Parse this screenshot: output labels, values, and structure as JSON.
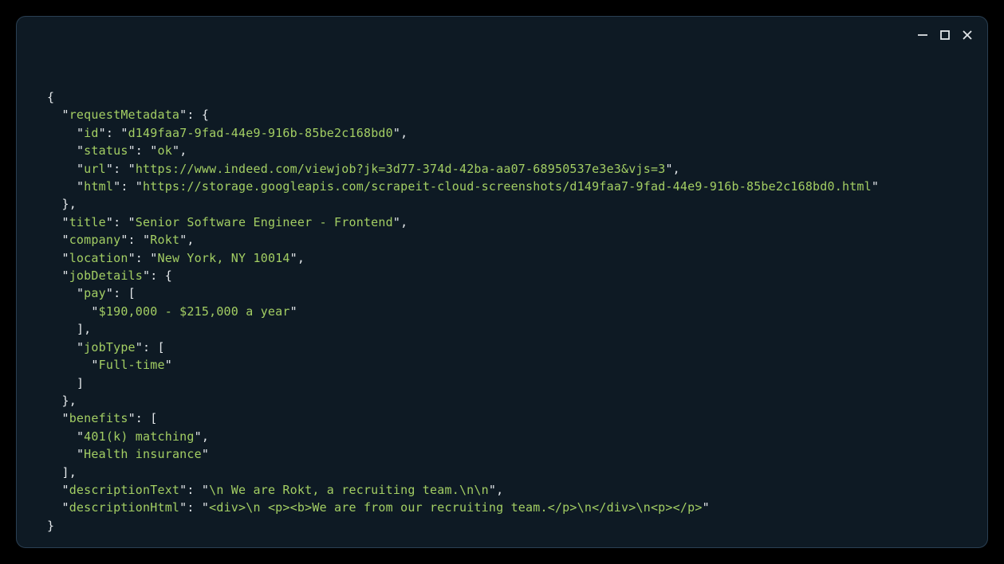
{
  "json": {
    "requestMetadata": {
      "id": "d149faa7-9fad-44e9-916b-85be2c168bd0",
      "status": "ok",
      "url": "https://www.indeed.com/viewjob?jk=3d77-374d-42ba-aa07-68950537e3e3&vjs=3",
      "html": "https://storage.googleapis.com/scrapeit-cloud-screenshots/d149faa7-9fad-44e9-916b-85be2c168bd0.html"
    },
    "title": "Senior Software Engineer - Frontend",
    "company": "Rokt",
    "location": "New York, NY 10014",
    "jobDetails": {
      "pay": [
        "$190,000 - $215,000 a year"
      ],
      "jobType": [
        "Full-time"
      ]
    },
    "benefits": [
      "401(k) matching",
      "Health insurance"
    ],
    "descriptionText": "\\n We are Rokt, a recruiting team.\\n\\n",
    "descriptionHtml": "<div>\\n <p><b>We are from our recruiting team.</p>\\n</div>\\n<p></p>"
  },
  "keys": {
    "requestMetadata": "requestMetadata",
    "id": "id",
    "status": "status",
    "url": "url",
    "html": "html",
    "title": "title",
    "company": "company",
    "location": "location",
    "jobDetails": "jobDetails",
    "pay": "pay",
    "jobType": "jobType",
    "benefits": "benefits",
    "descriptionText": "descriptionText",
    "descriptionHtml": "descriptionHtml"
  }
}
